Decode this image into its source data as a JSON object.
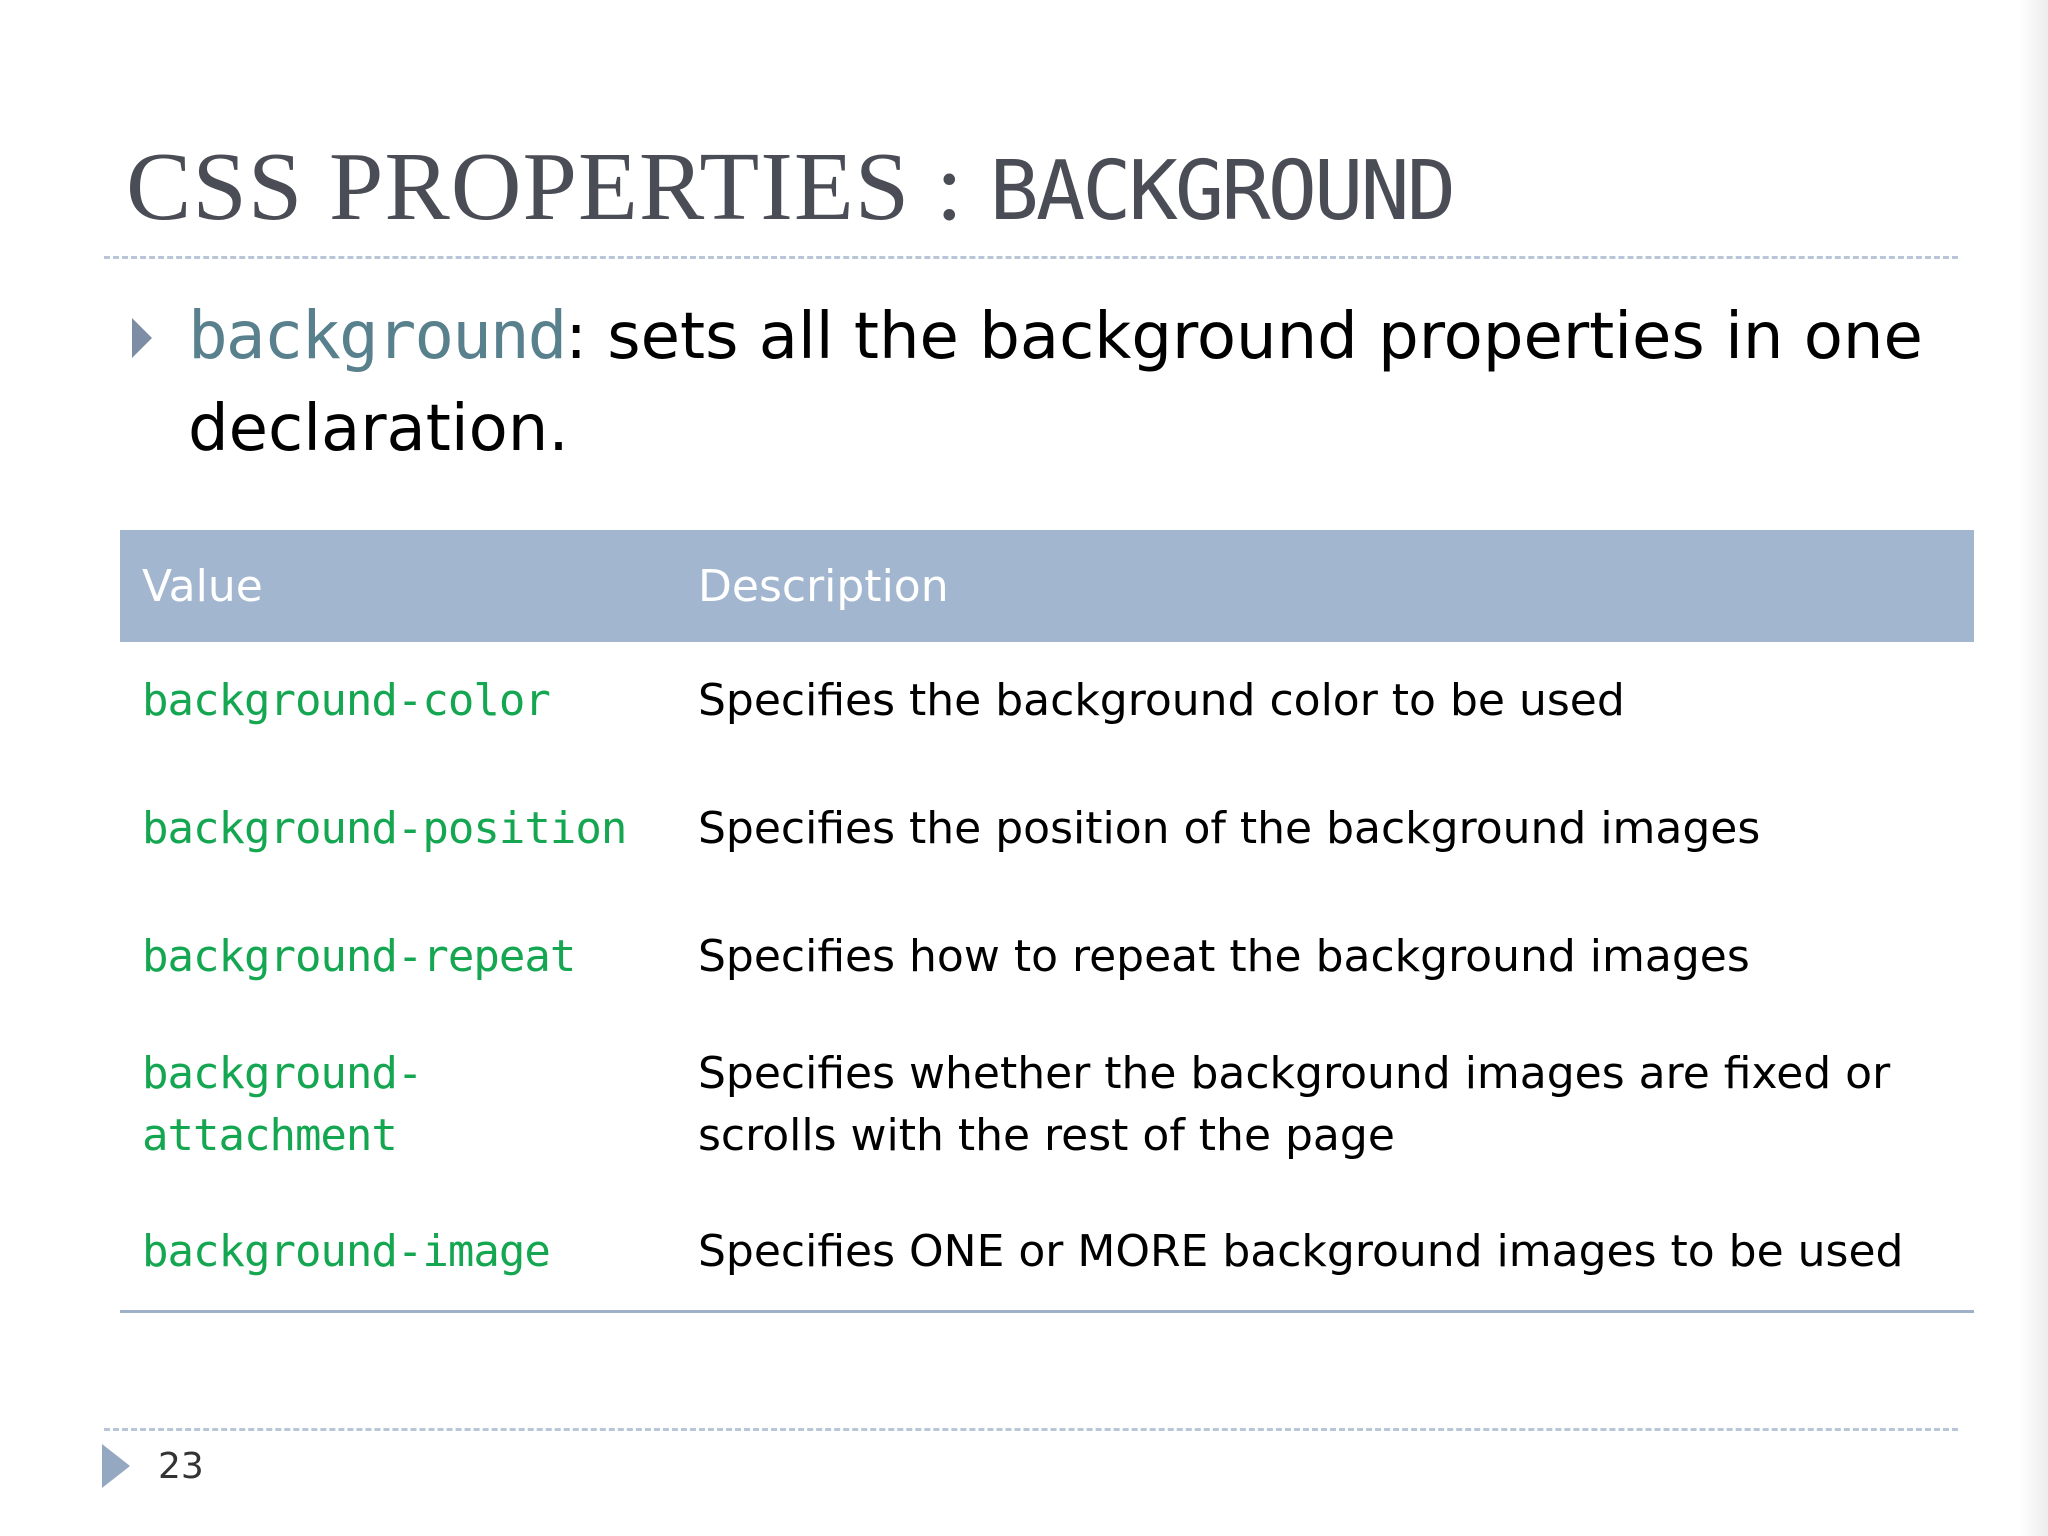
{
  "slide": {
    "title_part1": "CSS PROPERTIES : ",
    "title_part2": "BACKGROUND",
    "bullet": {
      "term": "background",
      "text": ": sets all the background properties in one declaration."
    },
    "table": {
      "headers": [
        "Value",
        "Description"
      ],
      "rows": [
        {
          "value": "background-color",
          "description": "Specifies the background color to be used"
        },
        {
          "value": "background-position",
          "description": "Specifies the position of the background images"
        },
        {
          "value": "background-repeat",
          "description": "Specifies how to repeat the background images"
        },
        {
          "value": "background-attachment",
          "description": "Specifies whether the background images are fixed or scrolls with the rest of the page"
        },
        {
          "value": "background-image",
          "description": "Specifies ONE or MORE background images to be used"
        }
      ]
    },
    "page_number": "23"
  },
  "colors": {
    "title": "#4a4d55",
    "code_term": "#58808d",
    "table_header_bg": "#a2b7cf",
    "value_green": "#14a650",
    "bullet_arrow": "#7e8da6"
  },
  "icons": {
    "bullet": "triangle-right-icon",
    "footer": "triangle-right-icon"
  }
}
